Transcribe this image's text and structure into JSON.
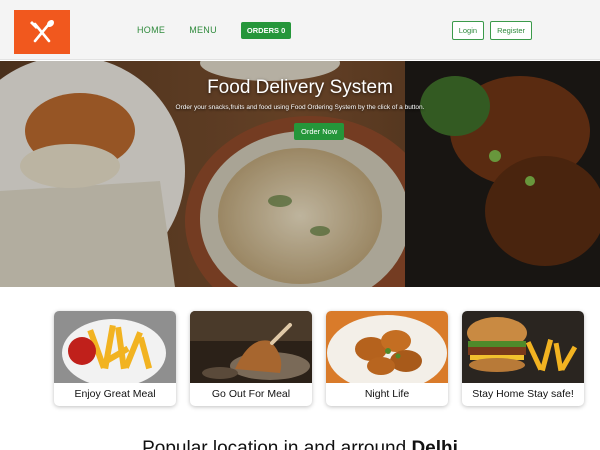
{
  "header": {
    "logo_icon": "fork-knife-icon",
    "brand_color": "#f1581e",
    "nav": [
      {
        "label": "HOME"
      },
      {
        "label": "MENU"
      }
    ],
    "orders_label": "ORDERS 0",
    "login_label": "Login",
    "register_label": "Register",
    "accent_color": "#25963a"
  },
  "hero": {
    "title": "Food Delivery System",
    "subtitle": "Order your snacks,fruits and food using Food Ordering System by the click of a button.",
    "cta_label": "Order Now"
  },
  "cards": [
    {
      "label": "Enjoy Great Meal",
      "icon": "french-fries-icon"
    },
    {
      "label": "Go Out For Meal",
      "icon": "restaurant-dish-icon"
    },
    {
      "label": "Night Life",
      "icon": "chicken-wings-icon"
    },
    {
      "label": "Stay Home Stay safe!",
      "icon": "burger-icon"
    }
  ],
  "section": {
    "title_prefix": "Popular location in and arround ",
    "title_city": "Delhi"
  }
}
